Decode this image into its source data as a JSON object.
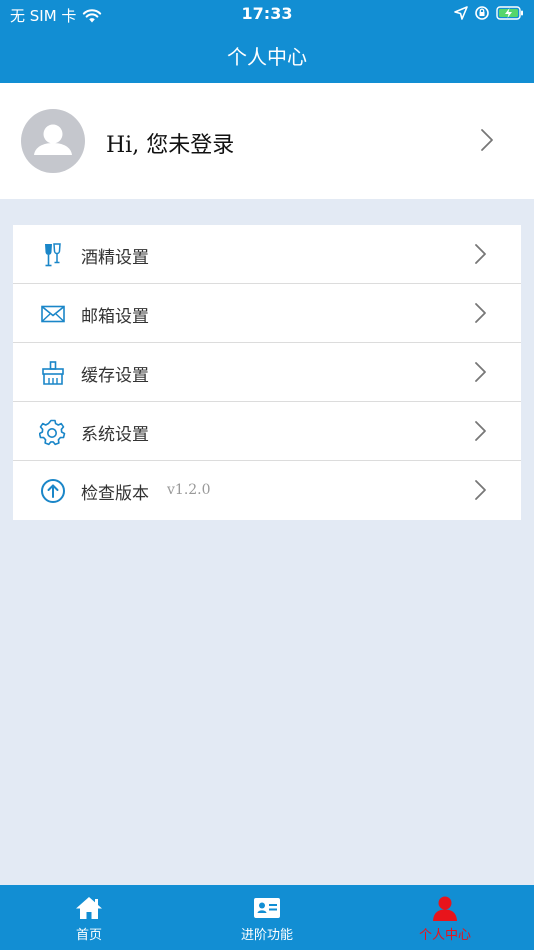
{
  "status_bar": {
    "carrier": "无 SIM 卡",
    "time": "17:33",
    "icons": [
      "wifi-icon",
      "location-icon",
      "lock-rotation-icon",
      "battery-charging-icon"
    ]
  },
  "nav": {
    "title": "个人中心"
  },
  "profile": {
    "greeting": "Hi, 您未登录",
    "icon": "avatar-placeholder-icon"
  },
  "menu": {
    "items": [
      {
        "label": "酒精设置",
        "icon": "wine-glass-icon"
      },
      {
        "label": "邮箱设置",
        "icon": "mail-icon"
      },
      {
        "label": "缓存设置",
        "icon": "broom-icon"
      },
      {
        "label": "系统设置",
        "icon": "gear-icon"
      },
      {
        "label": "检查版本",
        "icon": "upload-circle-icon",
        "version": "v1.2.0"
      }
    ]
  },
  "tabs": [
    {
      "label": "首页",
      "icon": "home-icon",
      "active": false
    },
    {
      "label": "进阶功能",
      "icon": "id-card-icon",
      "active": false
    },
    {
      "label": "个人中心",
      "icon": "person-icon",
      "active": true
    }
  ],
  "colors": {
    "primary": "#128ed3",
    "background": "#e3eaf4",
    "active_tab": "#e8141b",
    "icon_blue": "#1a86c8"
  }
}
